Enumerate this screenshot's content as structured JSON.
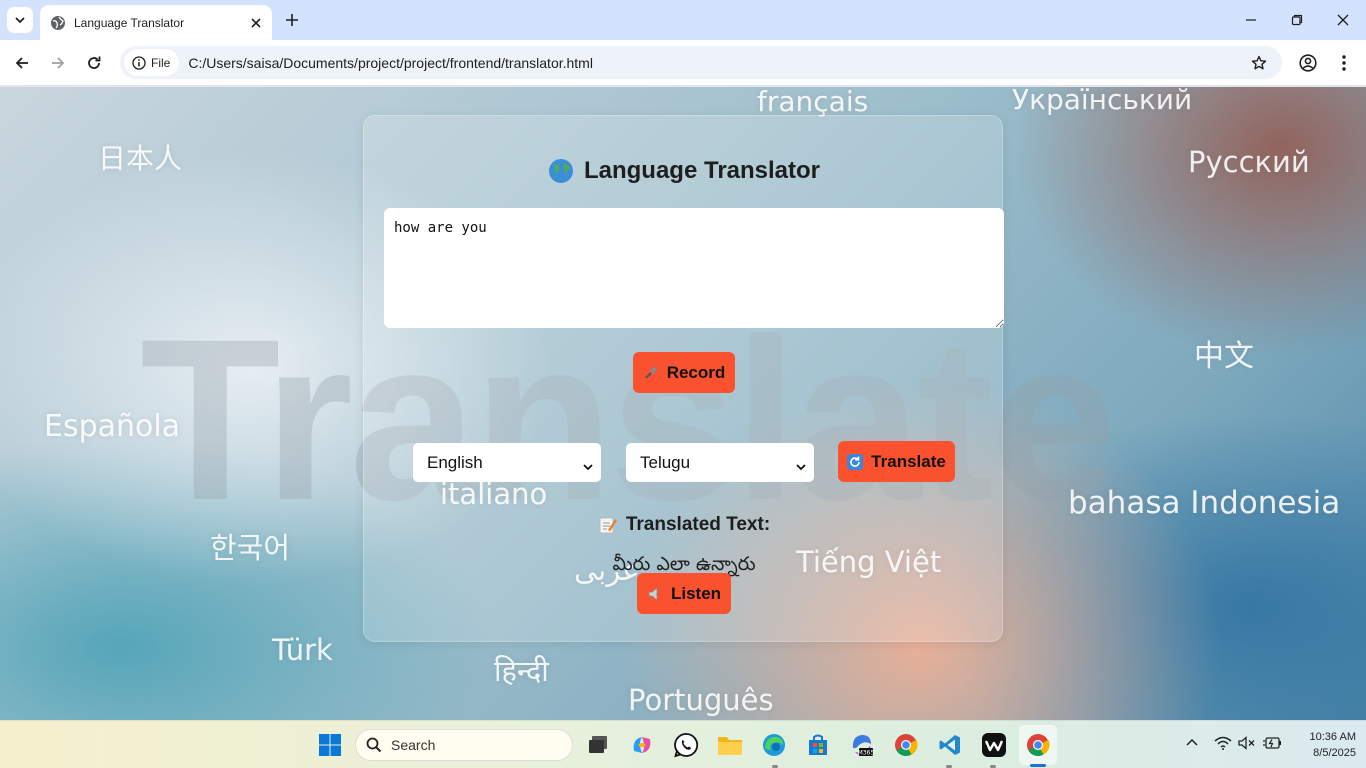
{
  "browser": {
    "tab_title": "Language Translator",
    "file_chip": "File",
    "url": "C:/Users/saisa/Documents/project/project/frontend/translator.html"
  },
  "background": {
    "words": [
      "français",
      "Український",
      "日本人",
      "Русский",
      "Española",
      "中文",
      "italiano",
      "bahasa Indonesia",
      "한국어",
      "Tiếng Việt",
      "عربى",
      "Türk",
      "हिन्दी",
      "Português"
    ],
    "big_word": "Translate"
  },
  "app": {
    "title": "Language Translator",
    "input_text": "how are you",
    "record_label": "Record",
    "source_language": "English",
    "target_language": "Telugu",
    "translate_label": "Translate",
    "result_heading": "Translated Text:",
    "result_text": "మీరు ఎలా ఉన్నారు",
    "listen_label": "Listen",
    "accent_color": "#fa512f"
  },
  "taskbar": {
    "search_label": "Search",
    "time": "10:36 AM",
    "date": "8/5/2025"
  }
}
